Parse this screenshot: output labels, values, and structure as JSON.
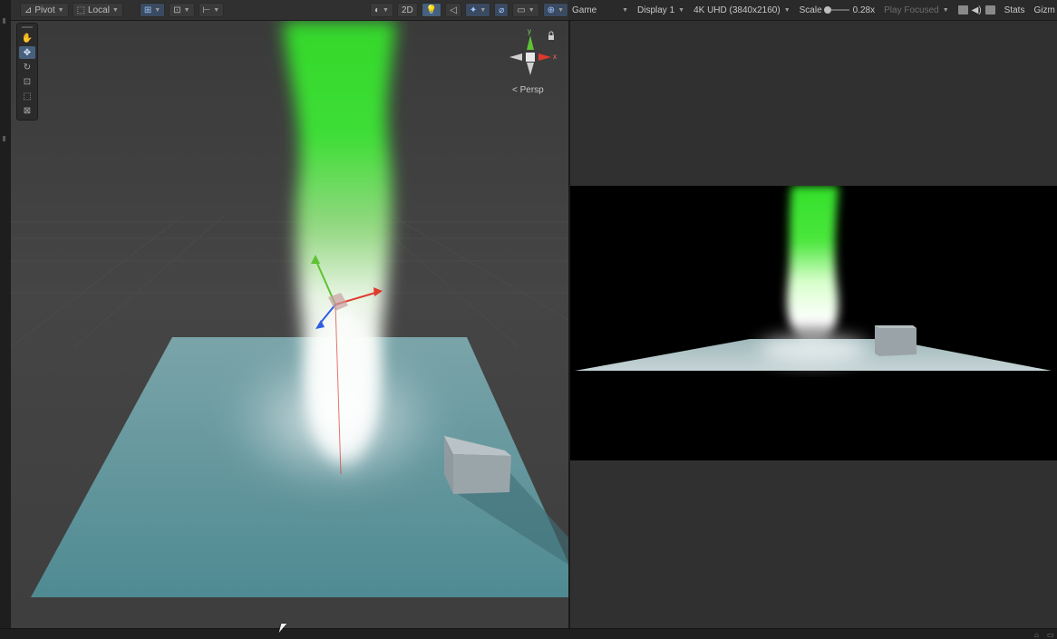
{
  "scene_toolbar": {
    "pivot_label": "Pivot",
    "local_label": "Local",
    "mode_2d_label": "2D",
    "icons": [
      "pivot-icon",
      "local-icon",
      "grid-snap-icon",
      "increment-snap-icon",
      "ruler-icon",
      "shading-mode-icon",
      "lighting-icon",
      "audio-icon",
      "effects-icon",
      "hidden-objects-icon",
      "gizmos-icon"
    ]
  },
  "game_toolbar": {
    "view_label": "Game",
    "display_label": "Display 1",
    "resolution_label": "4K UHD (3840x2160)",
    "scale_label": "Scale",
    "scale_value": "0.28x",
    "scale_fraction": 0.1,
    "play_mode_label": "Play Focused",
    "stats_label": "Stats",
    "gizmos_label": "Gizm"
  },
  "scene_tools": [
    "hand-tool",
    "move-tool",
    "rotate-tool",
    "scale-tool",
    "rect-tool",
    "transform-tool"
  ],
  "orientation_gizmo": {
    "y_label": "y",
    "x_label": "x",
    "persp_label": "< Persp"
  },
  "colors": {
    "beam_green": "#39e62e",
    "plane_blue": "#6e9ca3",
    "axis_x": "#e0392b",
    "axis_y": "#5ec232",
    "axis_z": "#2f5fe0",
    "active_tool": "#46607e"
  }
}
